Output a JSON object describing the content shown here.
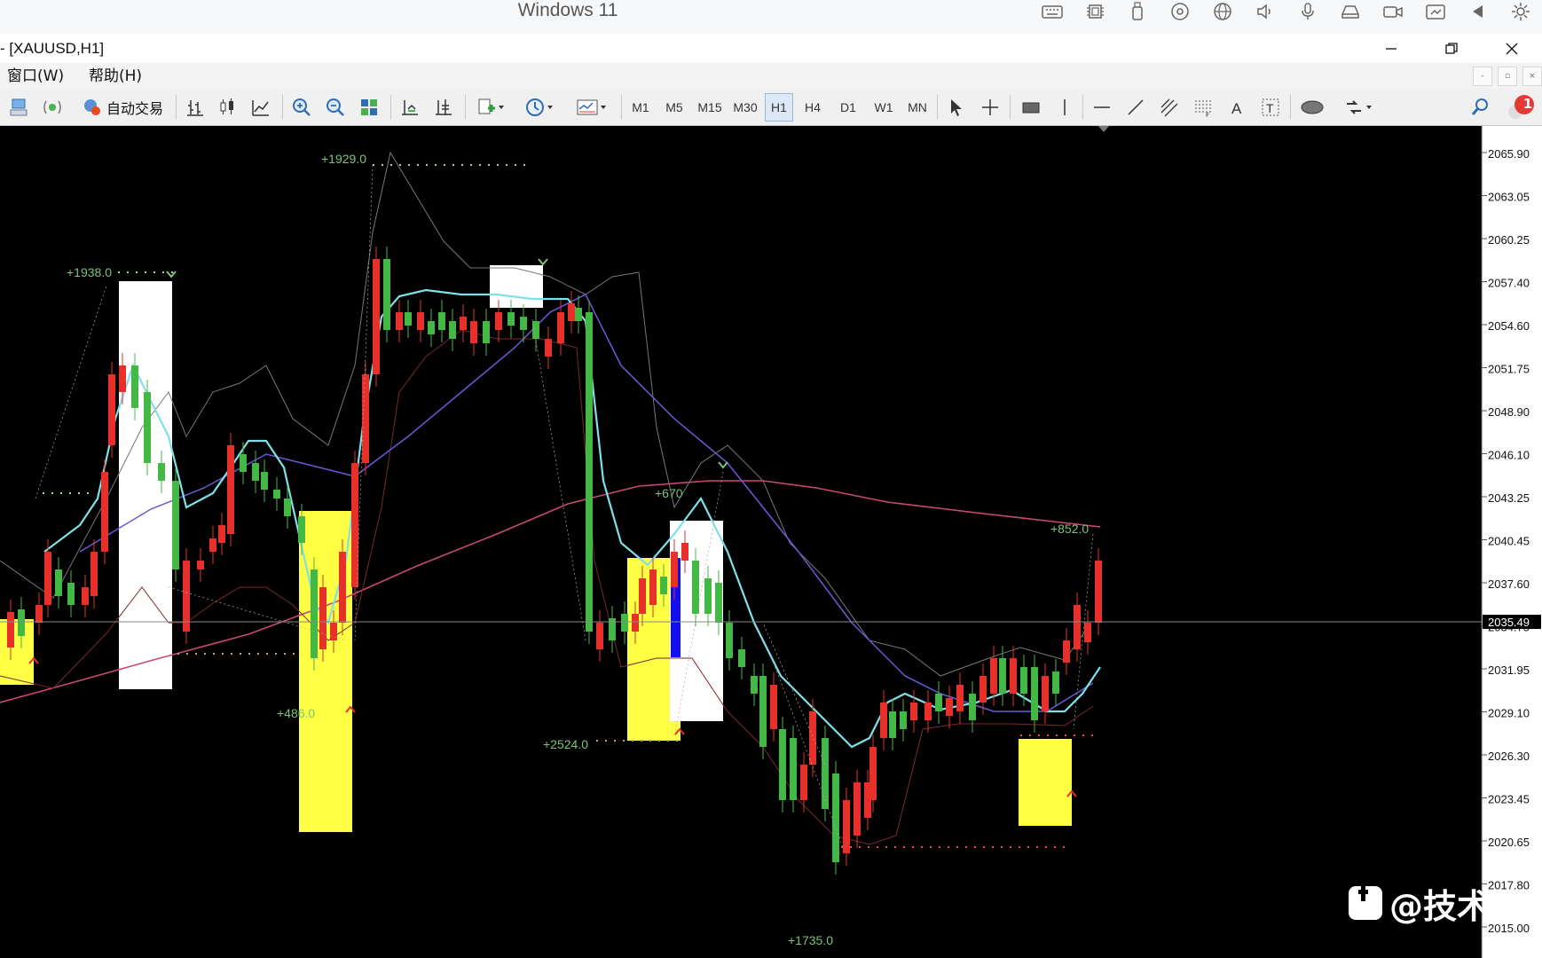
{
  "host": {
    "title": "Windows 11",
    "icons": [
      "keyboard-icon",
      "chip-icon",
      "usb-icon",
      "disc-icon",
      "globe-icon",
      "speaker-icon",
      "microphone-icon",
      "drive-icon",
      "camera-icon",
      "share-icon",
      "back-icon",
      "settings-icon"
    ]
  },
  "window": {
    "title": "- [XAUUSD,H1]"
  },
  "menu": {
    "window": "窗口(W)",
    "help": "帮助(H)"
  },
  "toolbar": {
    "auto_trading": "自动交易",
    "timeframes": [
      "M1",
      "M5",
      "M15",
      "M30",
      "H1",
      "H4",
      "D1",
      "W1",
      "MN"
    ],
    "active_timeframe": "H1",
    "notification_count": "1"
  },
  "chart": {
    "symbol": "XAUUSD",
    "timeframe": "H1",
    "background": "#000000",
    "bull_color": "#44b844",
    "bear_color": "#e8302a",
    "current_price": "2035.49",
    "price_axis": [
      "2065.90",
      "2063.05",
      "2060.25",
      "2057.40",
      "2054.60",
      "2051.75",
      "2048.90",
      "2046.10",
      "2043.25",
      "2040.45",
      "2037.60",
      "2034.75",
      "2031.95",
      "2029.10",
      "2026.30",
      "2023.45",
      "2020.65",
      "2017.80",
      "2015.00"
    ],
    "annotations": [
      "+1929.0",
      "+1938.0",
      "+486.0",
      "+2524.0",
      "+670",
      "+852.0",
      "+1735.0"
    ]
  },
  "watermark": {
    "text": "@技术刘"
  }
}
